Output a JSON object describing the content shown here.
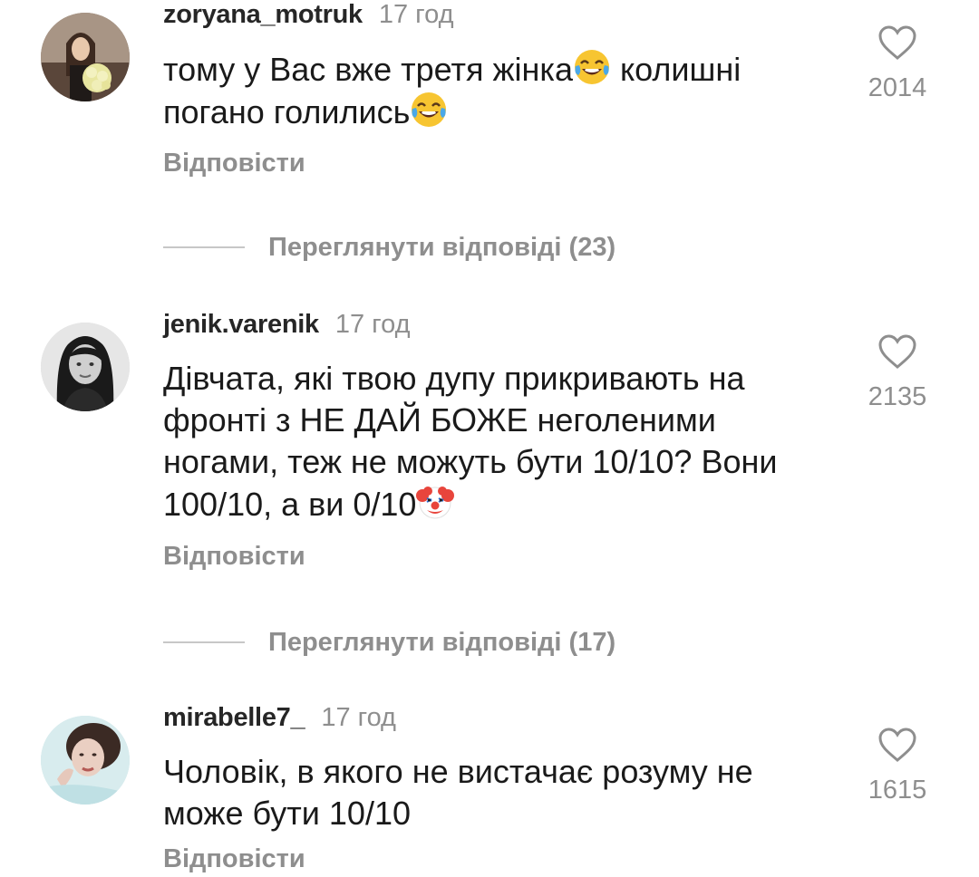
{
  "comments": [
    {
      "username": "zoryana_motruk",
      "time": "17 год",
      "text_before_emoji": "тому у Вас вже третя жінка",
      "text_after_emoji": " колишні погано голились",
      "emoji": "face-with-tears-of-joy",
      "likes": "2014",
      "reply_label": "Відповісти",
      "view_replies_label": "Переглянути відповіді (23)"
    },
    {
      "username": "jenik.varenik",
      "time": "17 год",
      "text": "Дівчата, які твою дупу прикривають на фронті з НЕ ДАЙ БОЖЕ неголеними ногами, теж не можуть бути 10/10? Вони 100/10, а ви 0/10",
      "emoji": "clown-face",
      "likes": "2135",
      "reply_label": "Відповісти",
      "view_replies_label": "Переглянути відповіді (17)"
    },
    {
      "username": "mirabelle7_",
      "time": "17 год",
      "text": "Чоловік, в якого не вистачає розуму не може бути 10/10",
      "likes": "1615",
      "reply_label": "Відповісти"
    }
  ],
  "icons": {
    "like": "heart-outline-icon"
  },
  "colors": {
    "secondary_text": "#8e8e8e",
    "primary_text": "#1a1a1a",
    "divider": "#c7c7c7"
  }
}
